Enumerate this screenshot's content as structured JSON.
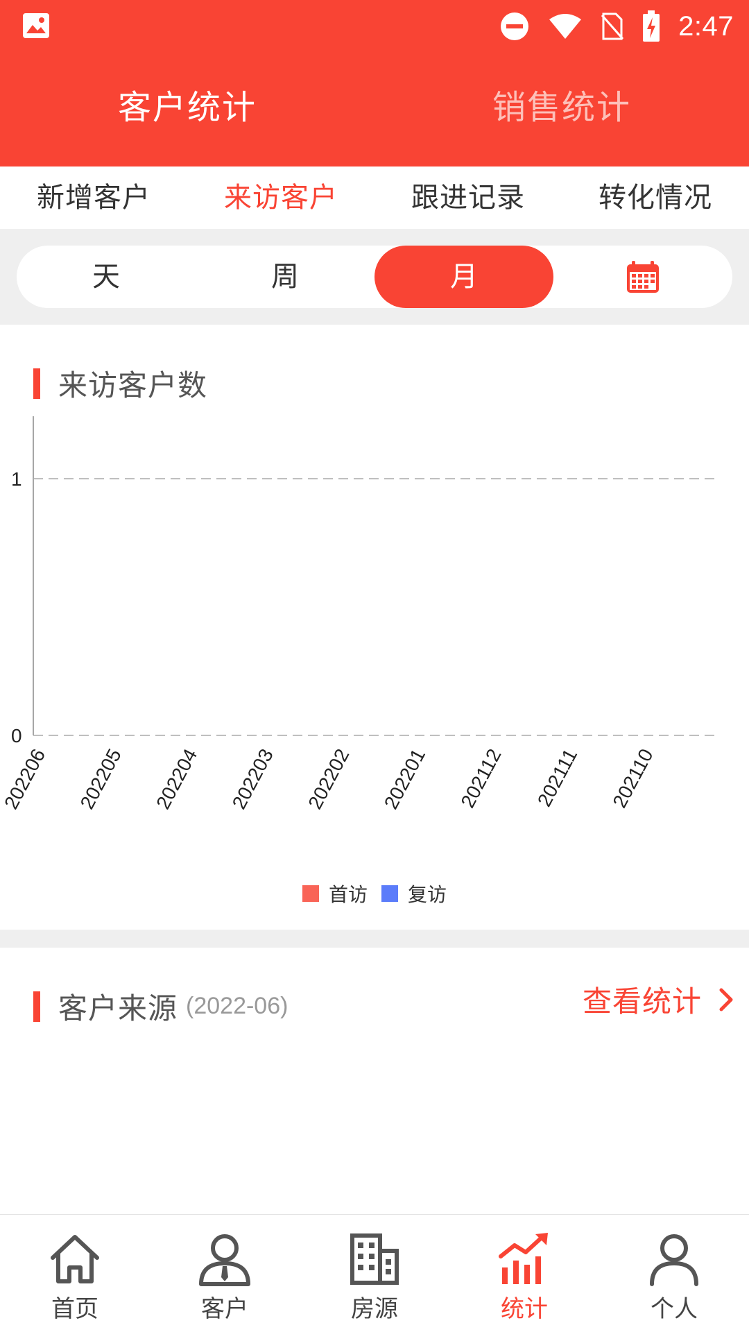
{
  "status_bar": {
    "time": "2:47"
  },
  "top_tabs": [
    {
      "label": "客户统计",
      "active": true
    },
    {
      "label": "销售统计",
      "active": false
    }
  ],
  "sub_tabs": [
    {
      "label": "新增客户",
      "active": false
    },
    {
      "label": "来访客户",
      "active": true
    },
    {
      "label": "跟进记录",
      "active": false
    },
    {
      "label": "转化情况",
      "active": false
    }
  ],
  "period": {
    "options": [
      "天",
      "周",
      "月"
    ],
    "selected": "月",
    "calendar_icon": "calendar-icon"
  },
  "visit_section": {
    "title": "来访客户数"
  },
  "chart_data": {
    "type": "bar",
    "categories": [
      "202206",
      "202205",
      "202204",
      "202203",
      "202202",
      "202201",
      "202112",
      "202111",
      "202110"
    ],
    "series": [
      {
        "name": "首访",
        "color": "#f96457",
        "values": [
          0,
          0,
          0,
          0,
          0,
          0,
          0,
          0,
          0
        ]
      },
      {
        "name": "复访",
        "color": "#5b7cfa",
        "values": [
          0,
          0,
          0,
          0,
          0,
          0,
          0,
          0,
          0
        ]
      }
    ],
    "y_ticks": [
      "0",
      "1"
    ],
    "ylim": [
      0,
      1
    ],
    "grid": "dashed horizontal",
    "legend": "bottom-center"
  },
  "source_section": {
    "title": "客户来源",
    "date": "(2022-06)",
    "view_stats": "查看统计"
  },
  "bottom_nav": [
    {
      "label": "首页",
      "icon": "home-icon",
      "active": false
    },
    {
      "label": "客户",
      "icon": "customer-icon",
      "active": false
    },
    {
      "label": "房源",
      "icon": "building-icon",
      "active": false
    },
    {
      "label": "统计",
      "icon": "stats-icon",
      "active": true
    },
    {
      "label": "个人",
      "icon": "person-icon",
      "active": false
    }
  ],
  "colors": {
    "accent": "#f94434",
    "divider": "#efefef"
  }
}
